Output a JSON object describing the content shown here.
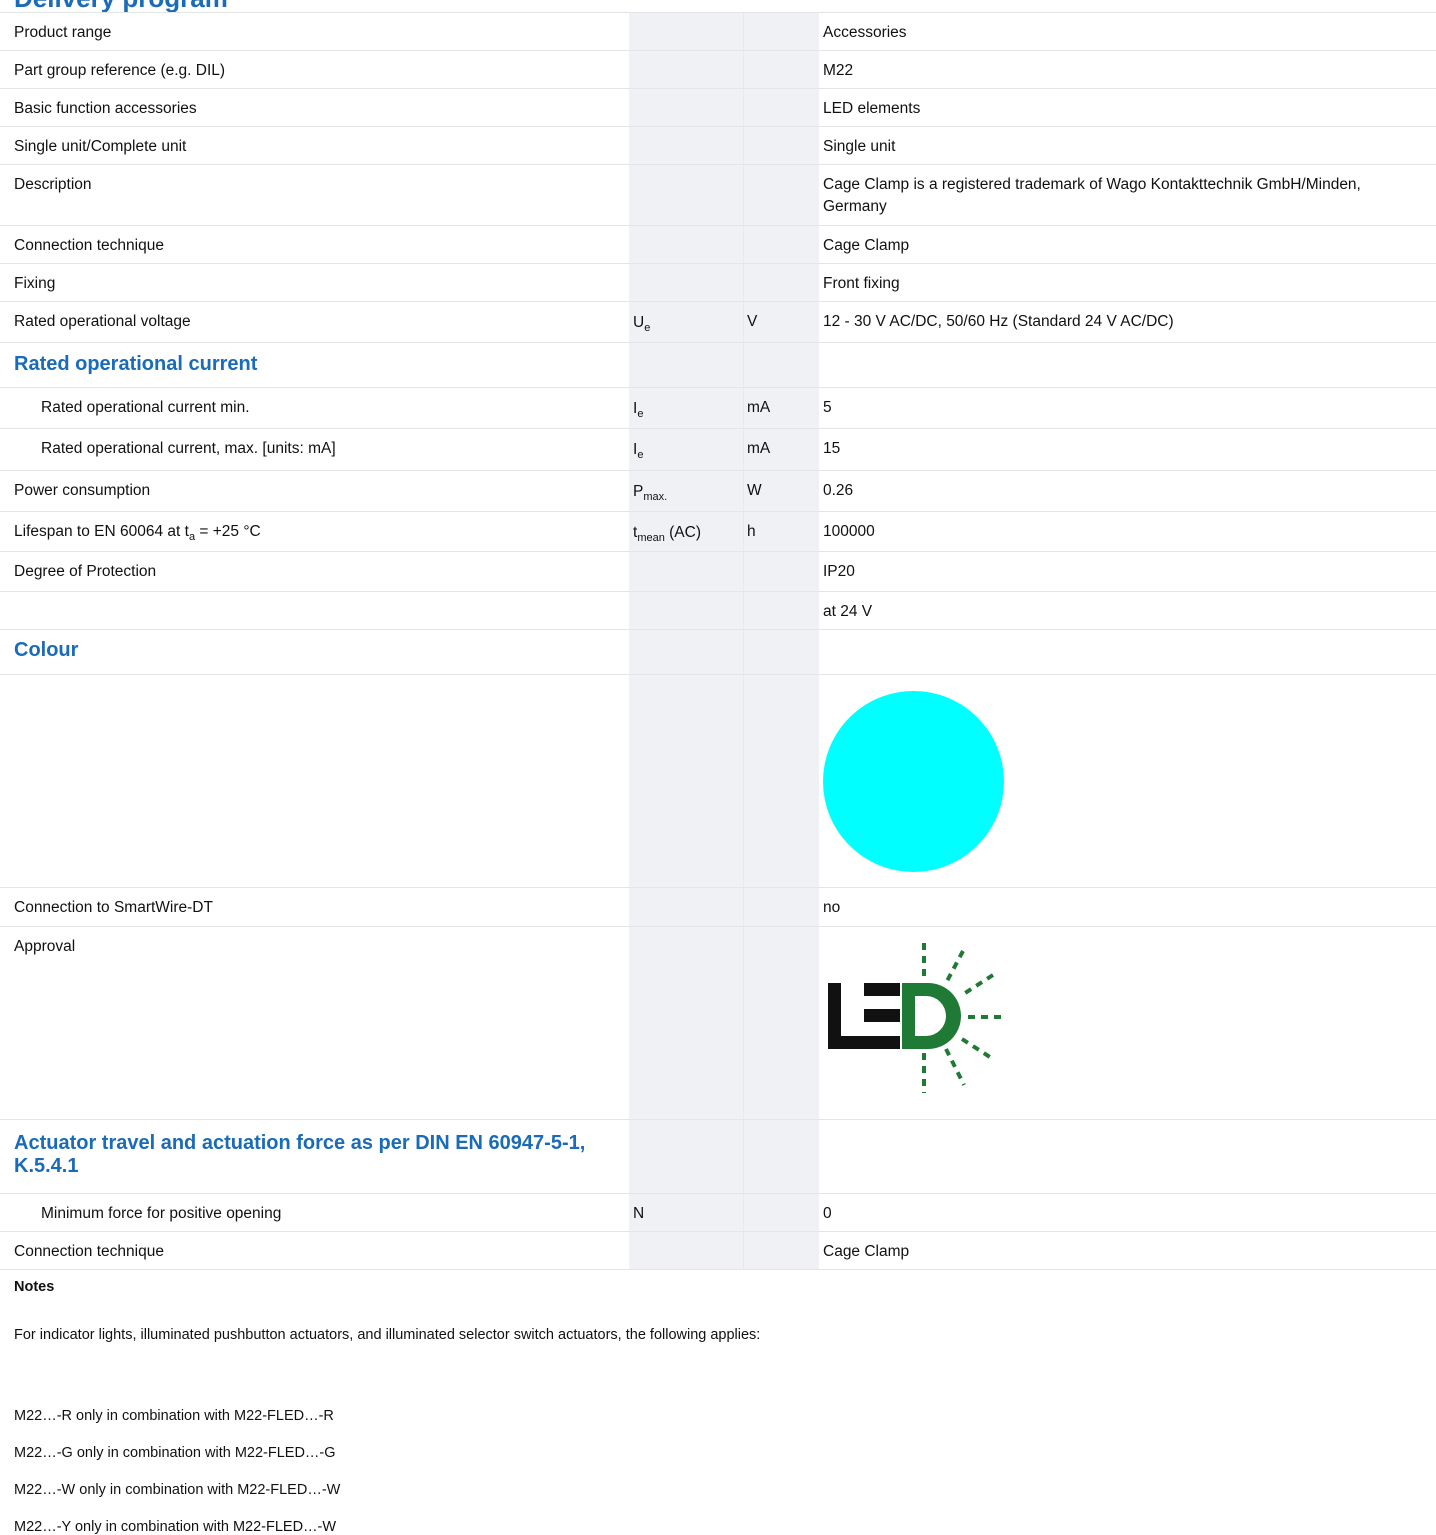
{
  "page": {
    "title": "Delivery program"
  },
  "rows": [
    {
      "label": "Product range",
      "value": "Accessories"
    },
    {
      "label": "Part group reference (e.g. DIL)",
      "value": "M22"
    },
    {
      "label": "Basic function accessories",
      "value": "LED elements"
    },
    {
      "label": "Single unit/Complete unit",
      "value": "Single unit"
    },
    {
      "label": "Description",
      "value": "Cage Clamp is a registered trademark of Wago Kontakttechnik GmbH/Minden, Germany"
    },
    {
      "label": "Connection technique",
      "value": "Cage Clamp"
    },
    {
      "label": "Fixing",
      "value": "Front fixing"
    },
    {
      "label": "Rated operational voltage",
      "symbol_main": "U",
      "symbol_sub": "e",
      "unit": "V",
      "value": "12 - 30 V AC/DC, 50/60 Hz (Standard 24 V AC/DC)"
    }
  ],
  "section_current": {
    "title": "Rated operational current",
    "rows": [
      {
        "label": "Rated operational current min.",
        "symbol_main": "I",
        "symbol_sub": "e",
        "unit": "mA",
        "value": "5"
      },
      {
        "label": "Rated operational current, max. [units: mA]",
        "symbol_main": "I",
        "symbol_sub": "e",
        "unit": "mA",
        "value": "15"
      }
    ]
  },
  "power": {
    "label": "Power consumption",
    "symbol_main": "P",
    "symbol_sub": "max.",
    "unit": "W",
    "value": "0.26"
  },
  "lifespan": {
    "label_pre": "Lifespan to EN 60064 at t",
    "label_sub": "a",
    "label_post": " = +25 °C",
    "symbol_main": "t",
    "symbol_sub": "mean",
    "symbol_post": " (AC)",
    "unit": "h",
    "value": "100000"
  },
  "protection": {
    "label": "Degree of Protection",
    "value": "IP20",
    "note_value": "at 24 V"
  },
  "section_colour": {
    "title": "Colour",
    "swatch_color": "#00ffff"
  },
  "smartwire": {
    "label": "Connection to SmartWire-DT",
    "value": "no"
  },
  "approval": {
    "label": "Approval",
    "logo_icon": "led-logo-icon"
  },
  "section_actuator": {
    "title": "Actuator travel and actuation force as per DIN EN 60947-5-1, K.5.4.1",
    "rows": [
      {
        "label": "Minimum force for positive opening",
        "symbol": "N",
        "value": "0"
      }
    ]
  },
  "connection2": {
    "label": "Connection technique",
    "value": "Cage Clamp"
  },
  "notes": {
    "title": "Notes",
    "intro": "For indicator lights, illuminated pushbutton actuators, and illuminated selector switch actuators, the following applies:",
    "items": [
      "M22…-R only in combination with M22-FLED…-R",
      "M22…-G only in combination with M22-FLED…-G",
      "M22…-W only in combination with M22-FLED…-W",
      "M22…-Y only in combination with M22-FLED…-W"
    ]
  }
}
